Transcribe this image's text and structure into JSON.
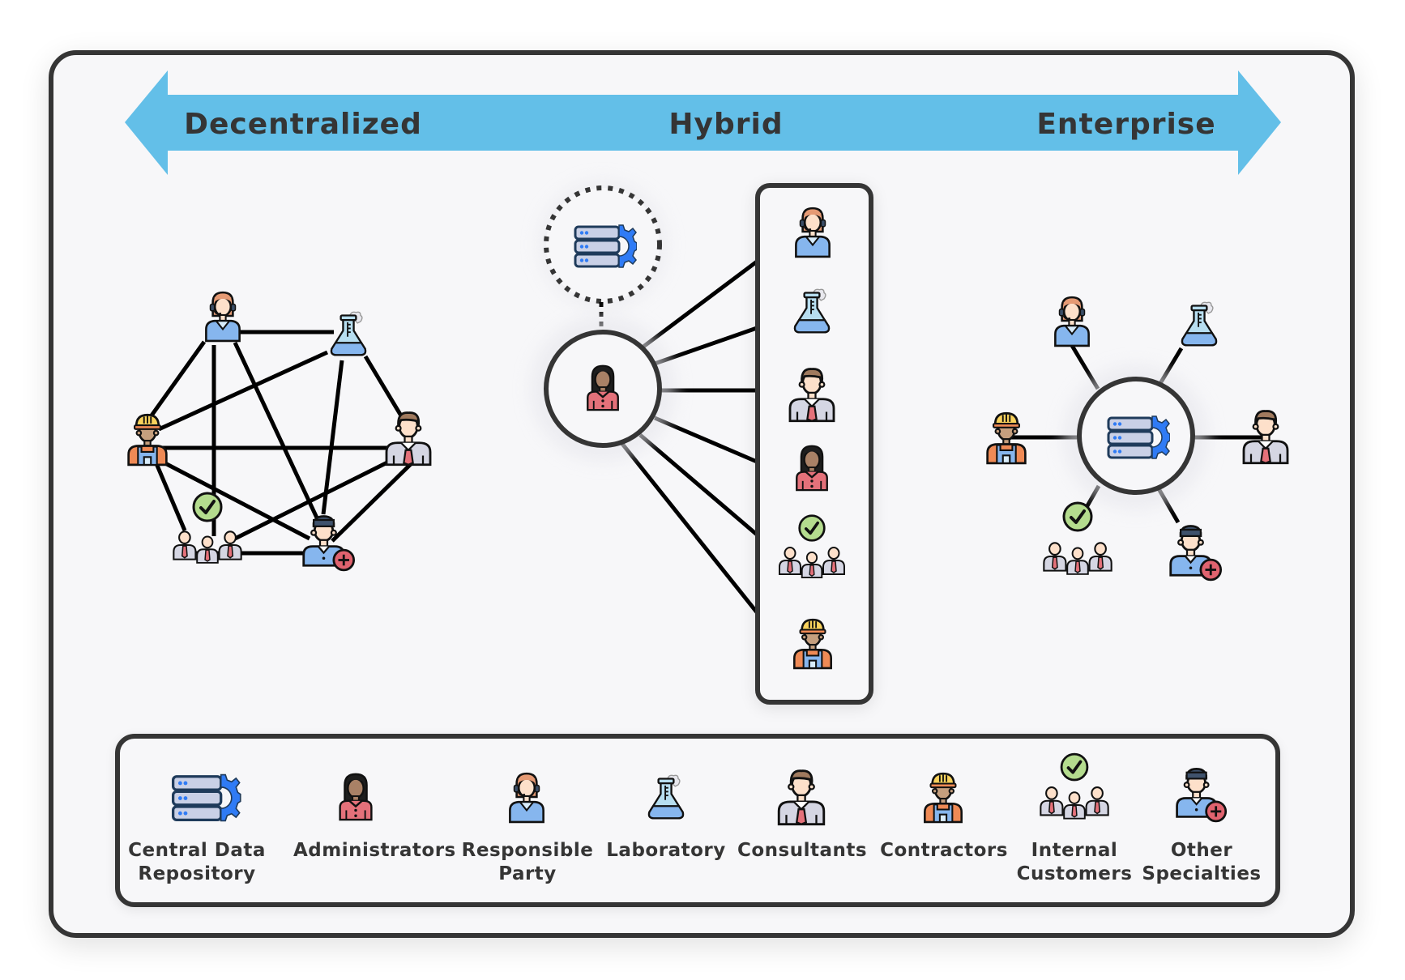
{
  "spectrum": {
    "left_label": "Decentralized",
    "center_label": "Hybrid",
    "right_label": "Enterprise",
    "arrow_color": "#63bfe8"
  },
  "models": [
    {
      "name": "Decentralized",
      "structure": "mesh",
      "members": [
        "Responsible Party",
        "Laboratory",
        "Contractors",
        "Consultants",
        "Internal Customers",
        "Other Specialties"
      ]
    },
    {
      "name": "Hybrid",
      "structure": "administrator hub linked to member group, dotted link to central data repository",
      "hub": "Administrators",
      "members": [
        "Responsible Party",
        "Laboratory",
        "Consultants",
        "Administrators",
        "Internal Customers",
        "Contractors"
      ]
    },
    {
      "name": "Enterprise",
      "structure": "star",
      "hub": "Central Data Repository",
      "members": [
        "Responsible Party",
        "Laboratory",
        "Contractors",
        "Consultants",
        "Internal Customers",
        "Other Specialties"
      ]
    }
  ],
  "legend": {
    "items": [
      {
        "icon": "server-gear-icon",
        "label": "Central Data\nRepository"
      },
      {
        "icon": "administrator-icon",
        "label": "Administrators"
      },
      {
        "icon": "responsible-party-icon",
        "label": "Responsible\nParty"
      },
      {
        "icon": "laboratory-flask-icon",
        "label": "Laboratory"
      },
      {
        "icon": "consultant-icon",
        "label": "Consultants"
      },
      {
        "icon": "contractor-icon",
        "label": "Contractors"
      },
      {
        "icon": "internal-customers-icon",
        "label": "Internal\nCustomers"
      },
      {
        "icon": "other-specialties-icon",
        "label": "Other\nSpecialties"
      }
    ]
  },
  "colors": {
    "outline": "#353535",
    "background": "#f7f7f9",
    "server_blue": "#2f7bf5",
    "server_panel": "#c9d0e6",
    "check_green": "#b4dc8e",
    "plus_red": "#e0636f",
    "shirt_blue": "#86b6ee",
    "shirt_pink": "#e4717a",
    "hardhat_yellow": "#f9d25c",
    "vest_orange": "#ef8a55"
  }
}
